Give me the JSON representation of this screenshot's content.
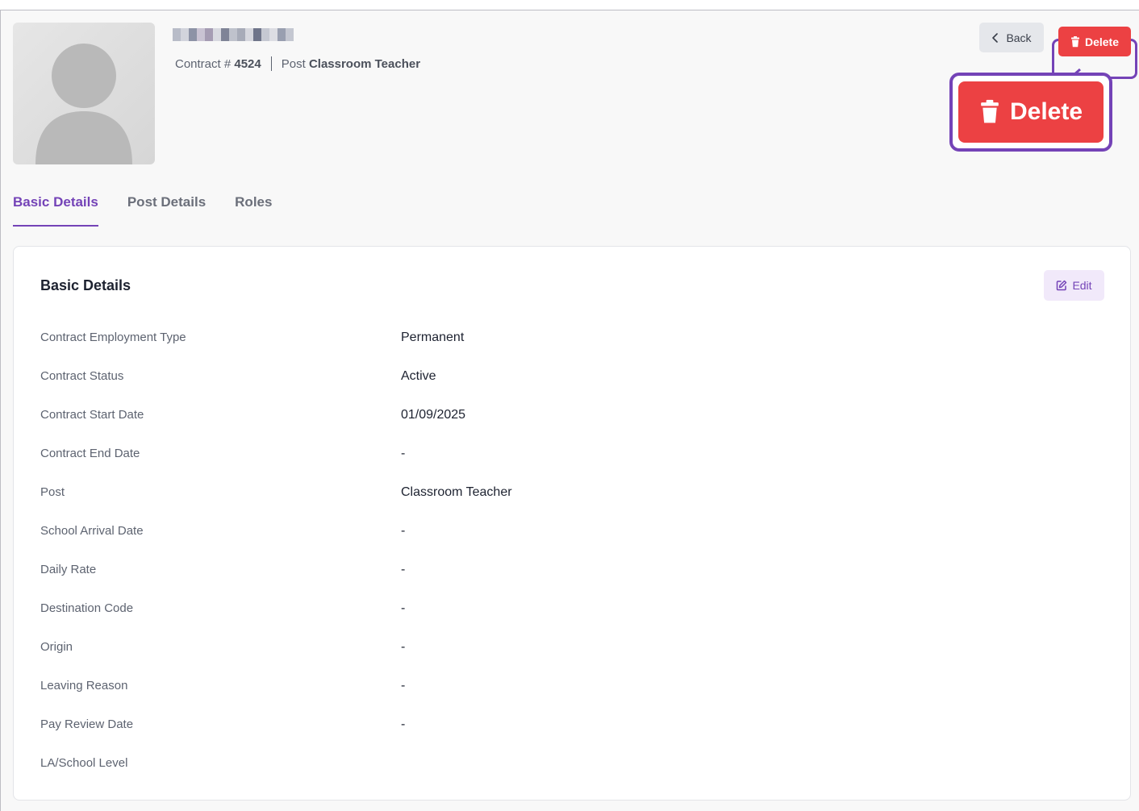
{
  "header": {
    "contract_label": "Contract #",
    "contract_number": "4524",
    "post_label": "Post",
    "post_title": "Classroom Teacher"
  },
  "actions": {
    "back_label": "Back",
    "delete_label": "Delete"
  },
  "zoom_callout": {
    "delete_label": "Delete"
  },
  "tabs": [
    {
      "label": "Basic Details",
      "active": true
    },
    {
      "label": "Post Details",
      "active": false
    },
    {
      "label": "Roles",
      "active": false
    }
  ],
  "card": {
    "title": "Basic Details",
    "edit_label": "Edit",
    "rows": [
      {
        "label": "Contract Employment Type",
        "value": "Permanent"
      },
      {
        "label": "Contract Status",
        "value": "Active"
      },
      {
        "label": "Contract Start Date",
        "value": "01/09/2025"
      },
      {
        "label": "Contract End Date",
        "value": "-"
      },
      {
        "label": "Post",
        "value": "Classroom Teacher"
      },
      {
        "label": "School Arrival Date",
        "value": "-"
      },
      {
        "label": "Daily Rate",
        "value": "-"
      },
      {
        "label": "Destination Code",
        "value": "-"
      },
      {
        "label": "Origin",
        "value": "-"
      },
      {
        "label": "Leaving Reason",
        "value": "-"
      },
      {
        "label": "Pay Review Date",
        "value": "-"
      },
      {
        "label": "LA/School Level",
        "value": ""
      }
    ]
  },
  "colors": {
    "accent": "#7443b7",
    "danger": "#ec4143",
    "highlight": "#7443b7"
  }
}
